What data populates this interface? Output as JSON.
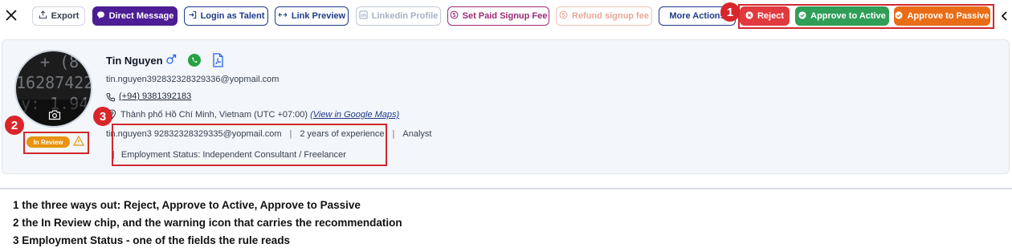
{
  "toolbar": {
    "export": "Export",
    "direct_message": "Direct Message",
    "login_as_talent": "Login as Talent",
    "link_preview": "Link Preview",
    "linkedin_profile": "Linkedin Profile",
    "set_paid_signup_fee": "Set Paid Signup Fee",
    "refund_signup_fee": "Refund signup fee",
    "more_actions": "More Actions",
    "reject": "Reject",
    "approve_to_active": "Approve to Active",
    "approve_to_passive": "Approve to Passive"
  },
  "annotations": {
    "one": "1",
    "two": "2",
    "three": "3"
  },
  "profile": {
    "name": "Tin Nguyen",
    "email": "tin.nguyen392832328329336@yopmail.com",
    "phone": "(+94) 9381392183",
    "location": "Thành phố Hồ Chí Minh, Vietnam (UTC +07:00)",
    "maps_link": "(View in Google Maps)",
    "meta_email": "tin.nguyen3 92832328329335@yopmail.com",
    "sep": "|",
    "experience": "2 years of experience",
    "role": "Analyst",
    "employment_status": "Employment Status: Independent Consultant / Freelancer",
    "status_chip": "In Review",
    "avatar_glyph_lines": [
      "+ (8",
      "16287422",
      "y: 1.94"
    ]
  },
  "notes": [
    "1  the three ways out: Reject, Approve to Active, Approve to Passive",
    "2  the In Review chip, and the warning icon that carries the recommendation",
    "3  Employment Status - one of the fields the rule reads"
  ],
  "colors": {
    "reject": "#e03a3e",
    "approve_active": "#2f9e57",
    "approve_passive": "#e86d16",
    "direct_message": "#4c1d95",
    "status_chip": "#e8920e",
    "annotation": "#d0282e"
  }
}
